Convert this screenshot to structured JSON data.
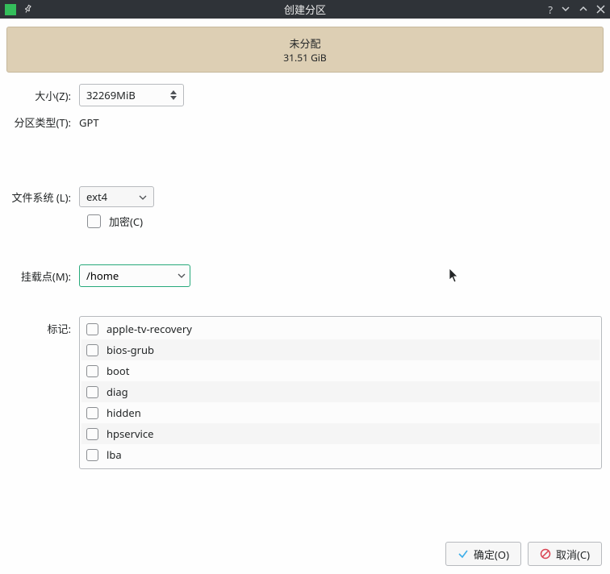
{
  "titlebar": {
    "title": "创建分区"
  },
  "unallocated": {
    "label": "未分配",
    "size": "31.51 GiB"
  },
  "form": {
    "size_label": "大小(Z):",
    "size_value": "32269MiB",
    "ptype_label": "分区类型(T):",
    "ptype_value": "GPT",
    "fs_label": "文件系统 (L):",
    "fs_value": "ext4",
    "encrypt_label": "加密(C)",
    "mount_label": "挂载点(M):",
    "mount_value": "/home",
    "flags_label": "标记:"
  },
  "flags": [
    "apple-tv-recovery",
    "bios-grub",
    "boot",
    "diag",
    "hidden",
    "hpservice",
    "lba"
  ],
  "buttons": {
    "ok": "确定(O)",
    "cancel": "取消(C)"
  }
}
